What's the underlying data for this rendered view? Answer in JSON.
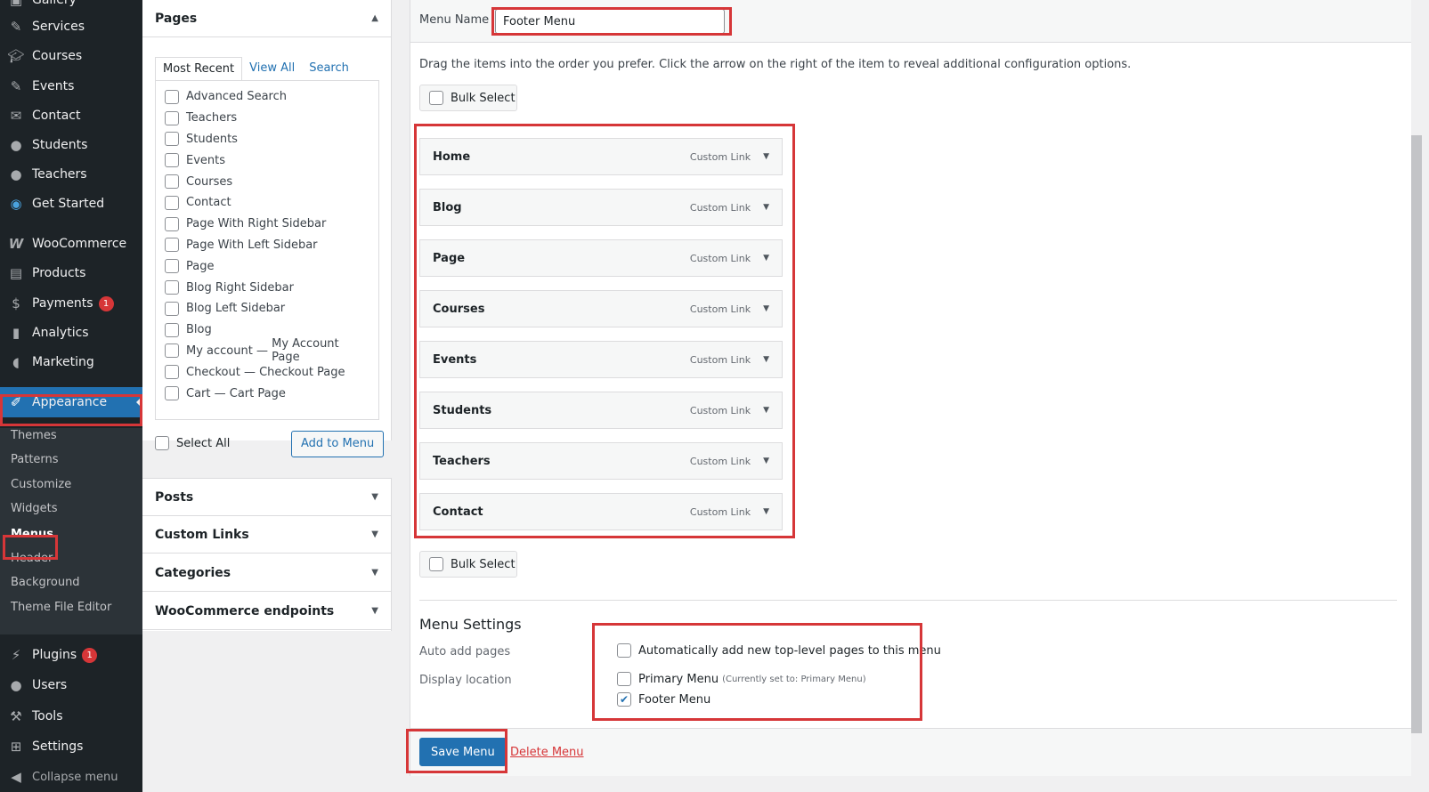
{
  "sidebar": {
    "items_top": [
      {
        "label": "Gallery",
        "icon": "gallery-icon"
      },
      {
        "label": "Services",
        "icon": "pin-icon"
      },
      {
        "label": "Courses",
        "icon": "graduation-cap-icon"
      },
      {
        "label": "Events",
        "icon": "pin-icon"
      },
      {
        "label": "Contact",
        "icon": "email-icon"
      },
      {
        "label": "Students",
        "icon": "user-icon"
      },
      {
        "label": "Teachers",
        "icon": "user-icon"
      },
      {
        "label": "Get Started",
        "icon": "globe-icon"
      },
      {
        "label": "WooCommerce",
        "icon": "woocommerce-icon"
      },
      {
        "label": "Products",
        "icon": "archive-icon"
      },
      {
        "label": "Payments",
        "icon": "dollar-icon",
        "badge": "1"
      },
      {
        "label": "Analytics",
        "icon": "bar-chart-icon"
      },
      {
        "label": "Marketing",
        "icon": "megaphone-icon"
      },
      {
        "label": "Appearance",
        "icon": "brush-icon"
      }
    ],
    "submenu": [
      "Themes",
      "Patterns",
      "Customize",
      "Widgets",
      "Menus",
      "Header",
      "Background",
      "Theme File Editor"
    ],
    "items_bottom": [
      {
        "label": "Plugins",
        "icon": "plugin-icon",
        "badge": "1"
      },
      {
        "label": "Users",
        "icon": "user-icon"
      },
      {
        "label": "Tools",
        "icon": "wrench-icon"
      },
      {
        "label": "Settings",
        "icon": "settings-icon"
      },
      {
        "label": "Collapse menu",
        "icon": "collapse-icon"
      }
    ]
  },
  "pages_panel": {
    "title": "Pages",
    "tabs": [
      "Most Recent",
      "View All",
      "Search"
    ],
    "items": [
      {
        "label": "Advanced Search"
      },
      {
        "label": "Teachers"
      },
      {
        "label": "Students"
      },
      {
        "label": "Events"
      },
      {
        "label": "Courses"
      },
      {
        "label": "Contact"
      },
      {
        "label": "Page With Right Sidebar"
      },
      {
        "label": "Page With Left Sidebar"
      },
      {
        "label": "Page"
      },
      {
        "label": "Blog Right Sidebar"
      },
      {
        "label": "Blog Left Sidebar"
      },
      {
        "label": "Blog"
      },
      {
        "label": "My account — ",
        "state": "My Account Page"
      },
      {
        "label": "Checkout — ",
        "state": "Checkout Page"
      },
      {
        "label": "Cart — ",
        "state": "Cart Page"
      }
    ],
    "select_all": "Select All",
    "add_button": "Add to Menu"
  },
  "other_panels": [
    "Posts",
    "Custom Links",
    "Categories",
    "WooCommerce endpoints"
  ],
  "editor": {
    "menu_name_label": "Menu Name",
    "menu_name_value": "Footer Menu",
    "instructions": "Drag the items into the order you prefer. Click the arrow on the right of the item to reveal additional configuration options.",
    "bulk_select": "Bulk Select",
    "item_type": "Custom Link",
    "items": [
      "Home",
      "Blog",
      "Page",
      "Courses",
      "Events",
      "Students",
      "Teachers",
      "Contact"
    ],
    "settings_title": "Menu Settings",
    "auto_add_label": "Auto add pages",
    "auto_add_option": "Automatically add new top-level pages to this menu",
    "display_location_label": "Display location",
    "locations": [
      {
        "label": "Primary Menu",
        "note": "(Currently set to: Primary Menu)",
        "checked": false
      },
      {
        "label": "Footer Menu",
        "note": "",
        "checked": true
      }
    ],
    "save_button": "Save Menu",
    "delete_link": "Delete Menu"
  },
  "colors": {
    "admin_bar": "#1d2327",
    "accent": "#2271b1",
    "highlight": "#d63638"
  }
}
